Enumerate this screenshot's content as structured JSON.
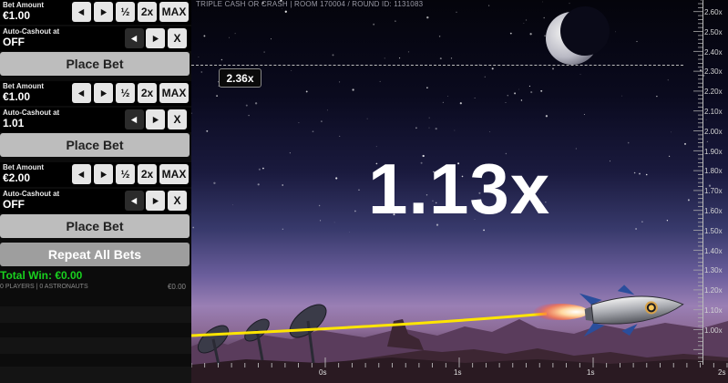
{
  "bets": [
    {
      "amount_label": "Bet Amount",
      "amount": "€1.00",
      "autocash_label": "Auto-Cashout at",
      "autocash": "OFF",
      "place_label": "Place Bet"
    },
    {
      "amount_label": "Bet Amount",
      "amount": "€1.00",
      "autocash_label": "Auto-Cashout at",
      "autocash": "1.01",
      "place_label": "Place Bet"
    },
    {
      "amount_label": "Bet Amount",
      "amount": "€2.00",
      "autocash_label": "Auto-Cashout at",
      "autocash": "OFF",
      "place_label": "Place Bet"
    }
  ],
  "controls": {
    "half": "½",
    "double": "2x",
    "max": "MAX",
    "clear": "X"
  },
  "repeat_label": "Repeat All Bets",
  "summary": {
    "total_win": "Total Win: €0.00",
    "players": "0 PLAYERS | 0 ASTRONAUTS",
    "amount": "€0.00"
  },
  "game": {
    "header": "TRIPLE CASH OR CRASH   |   ROOM 170004 / ROUND ID: 1131083",
    "multiplier": "1.13x",
    "target_tag": "2.36x",
    "y_ticks": [
      "2.60x",
      "2.50x",
      "2.40x",
      "2.30x",
      "2.20x",
      "2.10x",
      "2.00x",
      "1.90x",
      "1.80x",
      "1.70x",
      "1.60x",
      "1.50x",
      "1.40x",
      "1.30x",
      "1.20x",
      "1.10x",
      "1.00x"
    ],
    "x_ticks": [
      "0s",
      "1s",
      "1s",
      "2s"
    ]
  },
  "colors": {
    "win_green": "#19d11f",
    "trail_yellow": "#ffe500",
    "button_light": "#e6e6e6"
  }
}
